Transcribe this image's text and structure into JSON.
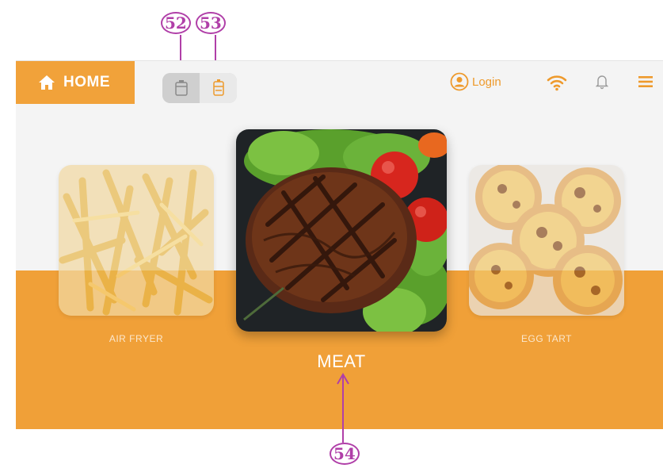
{
  "callouts": [
    "52",
    "53",
    "54"
  ],
  "header": {
    "home_label": "HOME",
    "login_label": "Login",
    "icons": [
      "home-icon",
      "cooking-device-icon",
      "second-device-icon",
      "user-icon",
      "wifi-icon",
      "bell-icon",
      "menu-icon"
    ]
  },
  "carousel": {
    "items": [
      {
        "label": "AIR FRYER",
        "image": "french-fries"
      },
      {
        "label": "MEAT",
        "image": "grilled-steak-with-tomato-and-lettuce"
      },
      {
        "label": "EGG TART",
        "image": "egg-tarts"
      }
    ]
  },
  "colors": {
    "accent": "#f1a23a",
    "callout": "#b03fa8",
    "background": "#f4f4f4"
  }
}
